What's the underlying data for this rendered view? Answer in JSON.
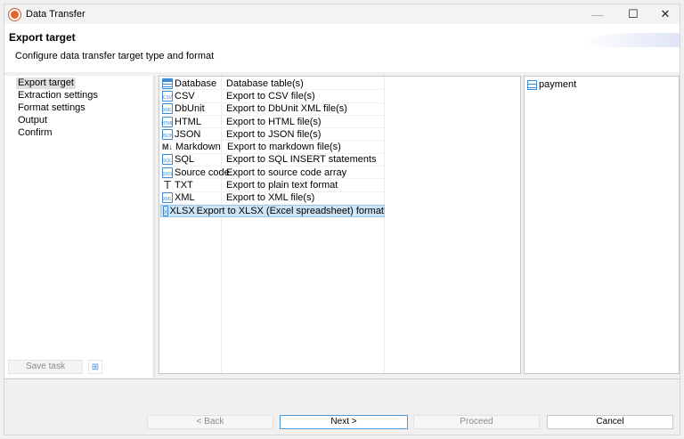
{
  "window": {
    "title": "Data Transfer",
    "controls": [
      "minimize",
      "maximize",
      "close"
    ]
  },
  "header": {
    "title": "Export target",
    "subtitle": "Configure data transfer target type and format"
  },
  "nav": {
    "items": [
      {
        "label": "Export target",
        "selected": true
      },
      {
        "label": "Extraction settings"
      },
      {
        "label": "Format settings"
      },
      {
        "label": "Output"
      },
      {
        "label": "Confirm"
      }
    ],
    "save_task": "Save task"
  },
  "formats": [
    {
      "name": "Database",
      "desc": "Database table(s)",
      "icon": "database-icon"
    },
    {
      "name": "CSV",
      "desc": "Export to CSV file(s)",
      "icon": "csv-file-icon",
      "tag": "CSV"
    },
    {
      "name": "DbUnit",
      "desc": "Export to DbUnit XML file(s)",
      "icon": "xml-file-icon",
      "tag": "XML"
    },
    {
      "name": "HTML",
      "desc": "Export to HTML file(s)",
      "icon": "html-file-icon",
      "tag": "HTML"
    },
    {
      "name": "JSON",
      "desc": "Export to JSON file(s)",
      "icon": "json-file-icon",
      "tag": "JSON"
    },
    {
      "name": "Markdown",
      "desc": "Export to markdown file(s)",
      "icon": "markdown-icon",
      "tag": "M↓"
    },
    {
      "name": "SQL",
      "desc": "Export to SQL INSERT statements",
      "icon": "sql-file-icon",
      "tag": "SQL"
    },
    {
      "name": "Source code",
      "desc": "Export to source code array",
      "icon": "source-code-icon",
      "tag": "0101"
    },
    {
      "name": "TXT",
      "desc": "Export to plain text format",
      "icon": "text-icon",
      "tag": "T"
    },
    {
      "name": "XML",
      "desc": "Export to XML file(s)",
      "icon": "xml-file-icon",
      "tag": "XML"
    },
    {
      "name": "XLSX",
      "desc": "Export to XLSX (Excel spreadsheet) format",
      "icon": "excel-file-icon",
      "tag": "X",
      "selected": true
    }
  ],
  "tables": [
    {
      "name": "payment"
    }
  ],
  "buttons": {
    "back": "< Back",
    "next": "Next >",
    "proceed": "Proceed",
    "cancel": "Cancel"
  },
  "colors": {
    "selection": "#cce4f7",
    "accent": "#3b8ad8"
  }
}
